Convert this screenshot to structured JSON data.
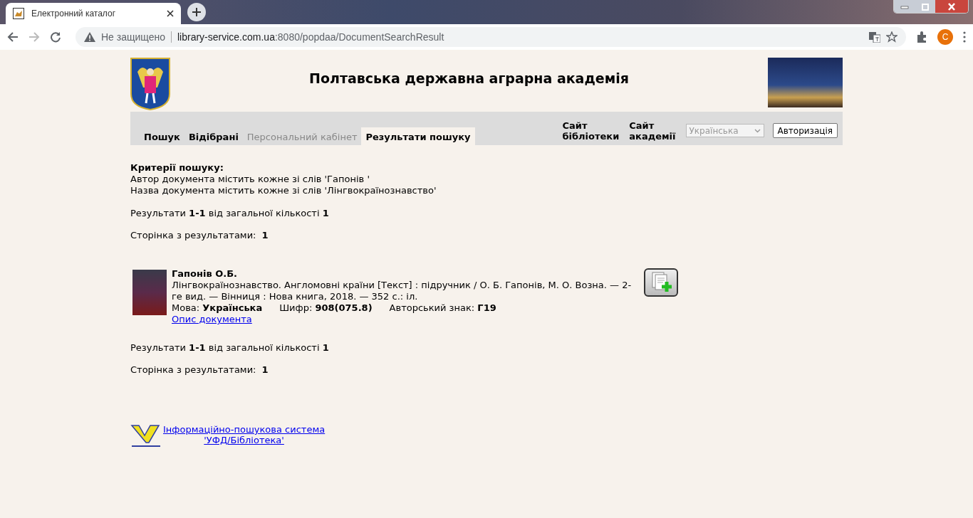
{
  "browser": {
    "tab_title": "Електронний каталог",
    "security": "Не защищено",
    "url_host": "library-service.com.ua",
    "url_rest": ":8080/popdaa/DocumentSearchResult",
    "profile": "C"
  },
  "header": {
    "title": "Полтавська державна аграрна академія"
  },
  "nav": {
    "tabs": [
      {
        "label": "Пошук",
        "selected": false,
        "disabled": false
      },
      {
        "label": "Відібрані",
        "selected": false,
        "disabled": false
      },
      {
        "label": "Персональний кабінет",
        "selected": false,
        "disabled": true
      },
      {
        "label": "Результати пошуку",
        "selected": true,
        "disabled": false
      }
    ],
    "links": [
      [
        "Сайт",
        "бібліотеки"
      ],
      [
        "Сайт",
        "академії"
      ]
    ],
    "language": {
      "value": "Українська",
      "disabled": true
    },
    "login_button": "Авторизація"
  },
  "criteria": {
    "heading": "Критерії пошуку:",
    "lines": [
      "Автор документа містить кожне зі слів 'Гапонів '",
      "Назва документа містить кожне зі слів 'Лінгвокраїнознавство'"
    ]
  },
  "summary_top": {
    "results": "Результати **1-1** від загальної кількості **1**",
    "pages_label": "Сторінка з результатами:",
    "pages": [
      "1"
    ]
  },
  "records": [
    {
      "author": "Гапонів О.Б.",
      "description": "Лінгвокраїнознавство. Англомовні країни [Текст] : підручник / О. Б. Гапонів, М. О. Возна. — 2-ге вид. — Вінниця : Нова книга, 2018. — 352 с.: іл.",
      "fields": [
        {
          "label": "Мова:",
          "value": "Українська"
        },
        {
          "label": "Шифр:",
          "value": "908(075.8)"
        },
        {
          "label": "Авторський знак:",
          "value": "Г19"
        }
      ],
      "link": "Опис документа"
    }
  ],
  "summary_bottom": {
    "results": "Результати **1-1** від загальної кількості **1**",
    "pages_label": "Сторінка з результатами:",
    "pages": [
      "1"
    ]
  },
  "footer": {
    "link_lines": [
      "Інформаційно-пошукова система",
      "'УФД/Бібліотека'"
    ]
  }
}
